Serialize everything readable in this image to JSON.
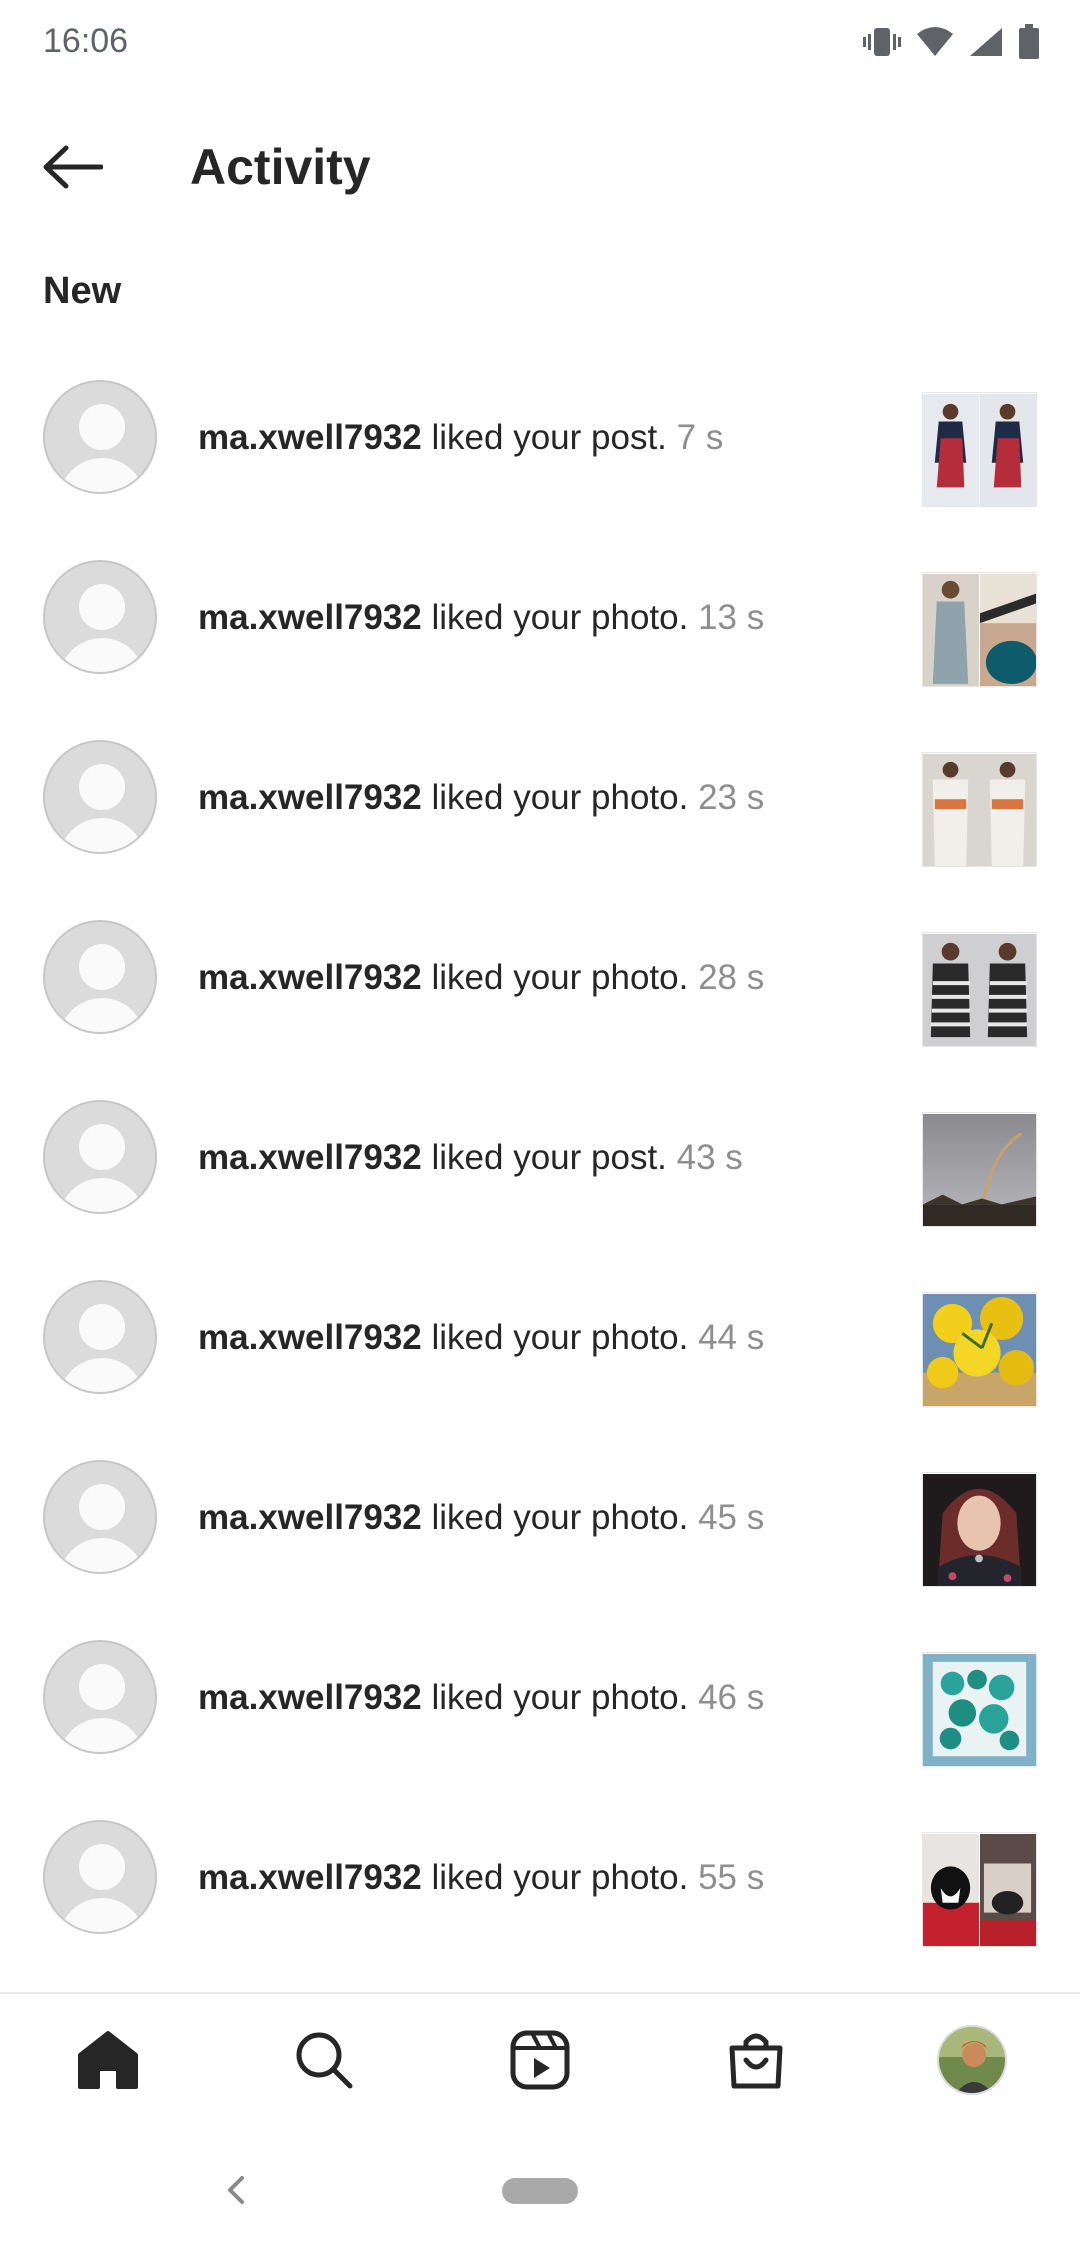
{
  "status_bar": {
    "time": "16:06"
  },
  "header": {
    "title": "Activity"
  },
  "section": {
    "title": "New"
  },
  "activities": [
    {
      "username": "ma.xwell7932",
      "action": " liked your post. ",
      "time": "7 s"
    },
    {
      "username": "ma.xwell7932",
      "action": " liked your photo. ",
      "time": "13 s"
    },
    {
      "username": "ma.xwell7932",
      "action": " liked your photo. ",
      "time": "23 s"
    },
    {
      "username": "ma.xwell7932",
      "action": " liked your photo. ",
      "time": "28 s"
    },
    {
      "username": "ma.xwell7932",
      "action": " liked your post. ",
      "time": "43 s"
    },
    {
      "username": "ma.xwell7932",
      "action": " liked your photo. ",
      "time": "44 s"
    },
    {
      "username": "ma.xwell7932",
      "action": " liked your photo. ",
      "time": "45 s"
    },
    {
      "username": "ma.xwell7932",
      "action": " liked your photo. ",
      "time": "46 s"
    },
    {
      "username": "ma.xwell7932",
      "action": " liked your photo. ",
      "time": "55 s"
    }
  ],
  "nav": {
    "items": [
      "home-icon",
      "search-icon",
      "reels-icon",
      "shop-icon",
      "profile-avatar"
    ]
  },
  "colors": {
    "text": "#262626",
    "secondary": "#8e8e8e",
    "avatar_bg": "#dbdbdb"
  }
}
